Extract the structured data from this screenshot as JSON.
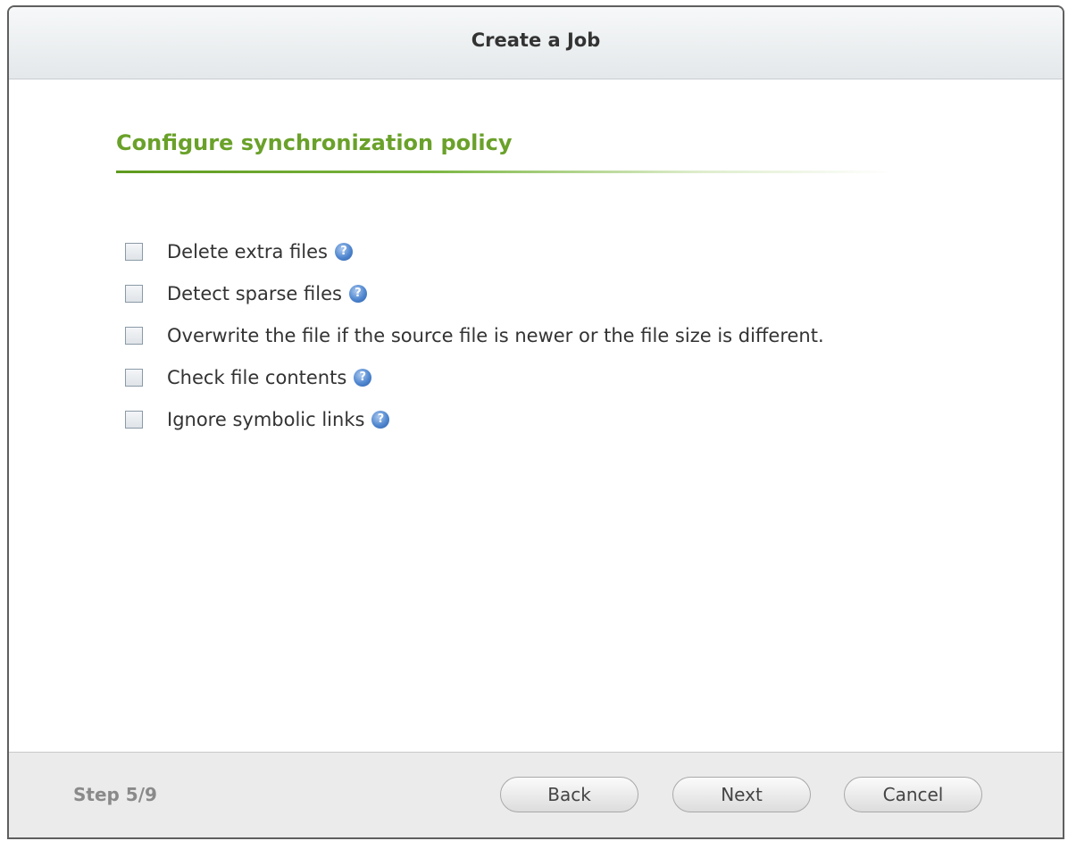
{
  "dialog": {
    "title": "Create a Job"
  },
  "section": {
    "heading": "Configure synchronization policy"
  },
  "options": [
    {
      "label": "Delete extra files",
      "checked": false,
      "has_help": true
    },
    {
      "label": "Detect sparse files",
      "checked": false,
      "has_help": true
    },
    {
      "label": "Overwrite the file if the source file is newer or the file size is different.",
      "checked": false,
      "has_help": false
    },
    {
      "label": "Check file contents",
      "checked": false,
      "has_help": true
    },
    {
      "label": "Ignore symbolic links",
      "checked": false,
      "has_help": true
    }
  ],
  "help_icon_glyph": "?",
  "footer": {
    "step": "Step 5/9",
    "back_label": "Back",
    "next_label": "Next",
    "cancel_label": "Cancel"
  },
  "colors": {
    "heading_green": "#6aa12a",
    "help_blue": "#4f86cf"
  }
}
